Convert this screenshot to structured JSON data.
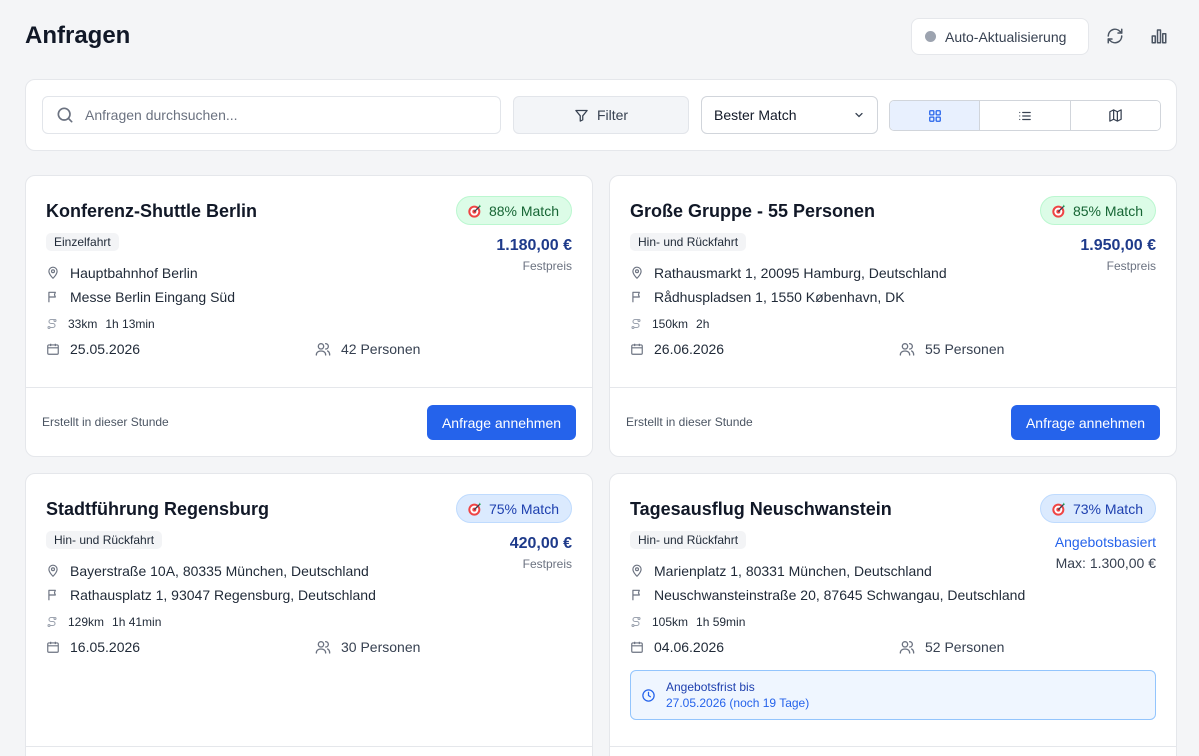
{
  "page": {
    "title": "Anfragen"
  },
  "header": {
    "auto_refresh_label": "Auto-Aktualisierung"
  },
  "toolbar": {
    "search_placeholder": "Anfragen durchsuchen...",
    "filter_label": "Filter",
    "sort_value": "Bester Match",
    "active_view": "grid"
  },
  "cards": [
    {
      "title": "Konferenz-Shuttle Berlin",
      "trip_type": "Einzelfahrt",
      "match": "88% Match",
      "match_color": "green",
      "price": "1.180,00 €",
      "price_type": "Festpreis",
      "from": "Hauptbahnhof Berlin",
      "to": "Messe Berlin Eingang Süd",
      "distance": "33km",
      "duration": "1h 13min",
      "date": "25.05.2026",
      "persons": "42 Personen",
      "created": "Erstellt in dieser Stunde",
      "action": "Anfrage annehmen"
    },
    {
      "title": "Große Gruppe - 55 Personen",
      "trip_type": "Hin- und Rückfahrt",
      "match": "85% Match",
      "match_color": "green",
      "price": "1.950,00 €",
      "price_type": "Festpreis",
      "from": "Rathausmarkt 1, 20095 Hamburg, Deutschland",
      "to": "Rådhuspladsen 1, 1550 København, DK",
      "distance": "150km",
      "duration": "2h",
      "date": "26.06.2026",
      "persons": "55 Personen",
      "created": "Erstellt in dieser Stunde",
      "action": "Anfrage annehmen"
    },
    {
      "title": "Stadtführung Regensburg",
      "trip_type": "Hin- und Rückfahrt",
      "match": "75% Match",
      "match_color": "blue",
      "price": "420,00 €",
      "price_type": "Festpreis",
      "from": "Bayerstraße 10A, 80335 München, Deutschland",
      "to": "Rathausplatz 1, 93047 Regensburg, Deutschland",
      "distance": "129km",
      "duration": "1h 41min",
      "date": "16.05.2026",
      "persons": "30 Personen"
    },
    {
      "title": "Tagesausflug Neuschwanstein",
      "trip_type": "Hin- und Rückfahrt",
      "match": "73% Match",
      "match_color": "blue",
      "offer_link": "Angebotsbasiert",
      "offer_max": "Max: 1.300,00 €",
      "from": "Marienplatz 1, 80331 München, Deutschland",
      "to": "Neuschwansteinstraße 20, 87645 Schwangau, Deutschland",
      "distance": "105km",
      "duration": "1h 59min",
      "date": "04.06.2026",
      "persons": "52 Personen",
      "deadline_label": "Angebotsfrist bis",
      "deadline_value": "27.05.2026 (noch 19 Tage)"
    }
  ]
}
